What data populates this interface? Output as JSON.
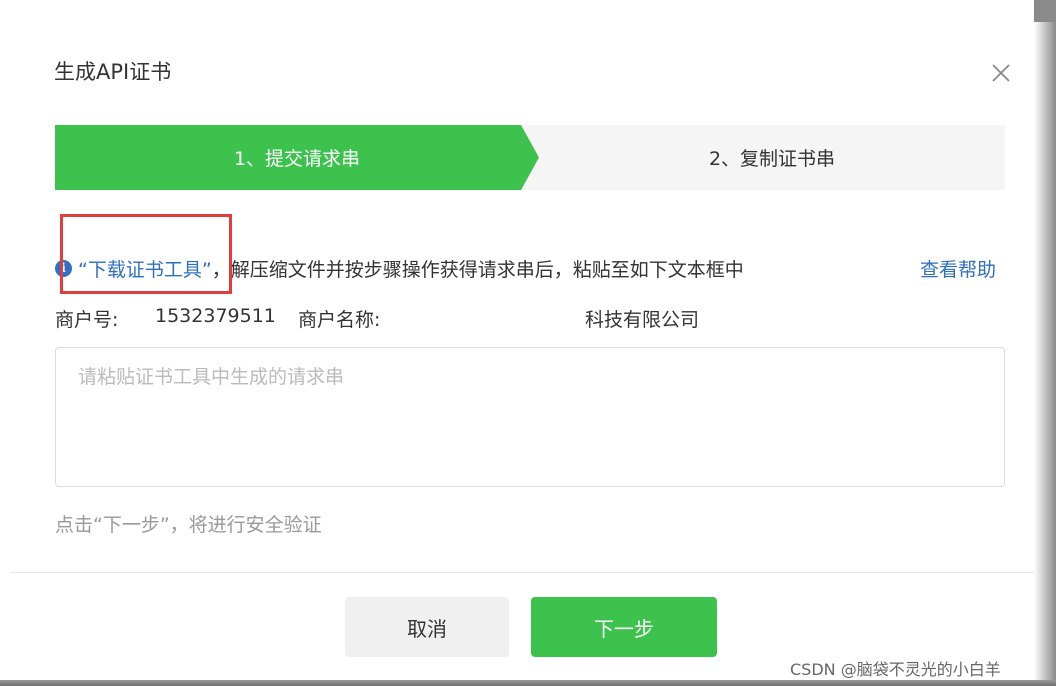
{
  "dialog": {
    "title": "生成API证书",
    "close_icon": "close-icon"
  },
  "steps": [
    {
      "label": "1、提交请求串",
      "active": true
    },
    {
      "label": "2、复制证书串",
      "active": false
    }
  ],
  "info": {
    "icon": "info-icon",
    "icon_glyph": "i",
    "download_link": "“下载证书工具”",
    "text": "，解压缩文件并按步骤操作获得请求串后，粘贴至如下文本框中",
    "help_link": "查看帮助"
  },
  "merchant": {
    "id_label": "商户号:",
    "id_value": "1532379511",
    "name_label": "商户名称:",
    "name_value": "科技有限公司"
  },
  "request_input": {
    "placeholder": "请粘贴证书工具中生成的请求串",
    "value": ""
  },
  "hint": "点击“下一步”，将进行安全验证",
  "buttons": {
    "cancel": "取消",
    "next": "下一步"
  },
  "watermark": "CSDN @脑袋不灵光的小白羊",
  "colors": {
    "accent_green": "#3dc34d",
    "link_blue": "#2e6fc2",
    "highlight_red": "#e23c3c"
  }
}
